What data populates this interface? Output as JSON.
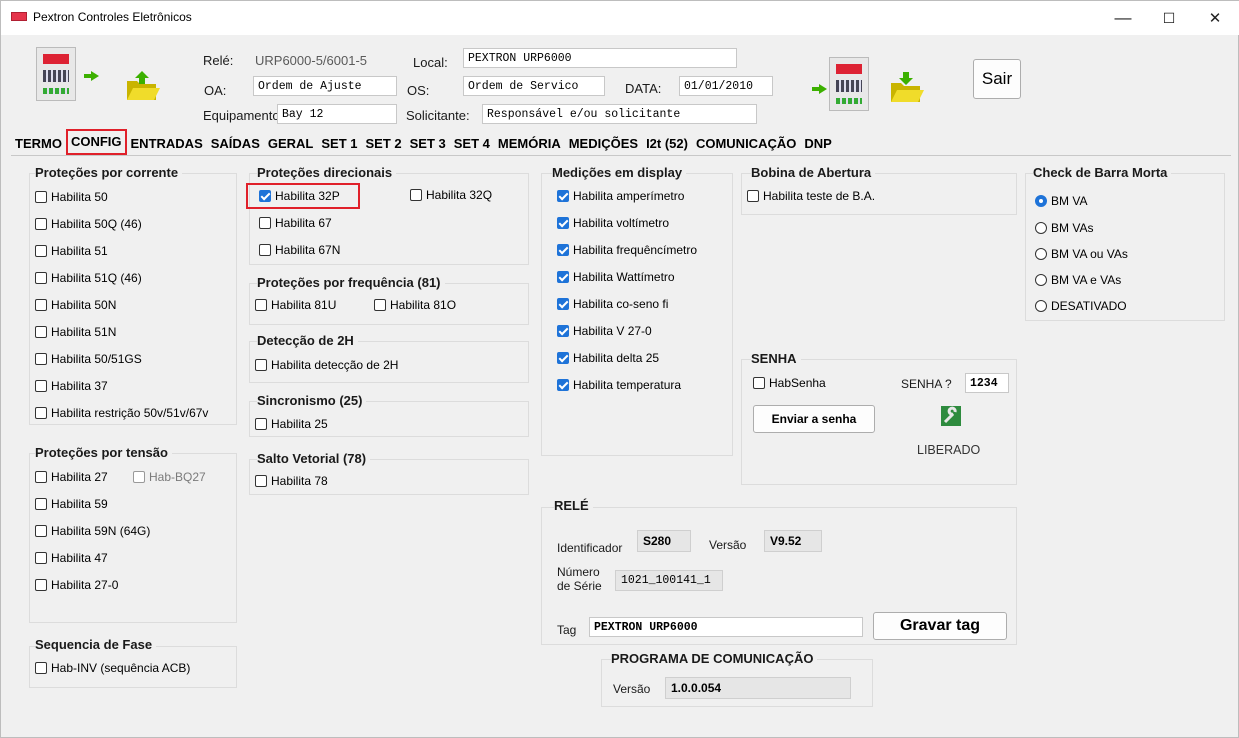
{
  "window": {
    "title": "Pextron Controles Eletrônicos",
    "min": "—",
    "max": "☐",
    "close": "✕"
  },
  "header": {
    "rele_label": "Relé:",
    "rele_value": "URP6000-5/6001-5",
    "local_label": "Local:",
    "local_value": "PEXTRON URP6000",
    "oa_label": "OA:",
    "oa_value": "Ordem de Ajuste",
    "os_label": "OS:",
    "os_value": "Ordem de Servico",
    "data_label": "DATA:",
    "data_value": "01/01/2010",
    "equip_label": "Equipamento:",
    "equip_value": "Bay 12",
    "solic_label": "Solicitante:",
    "solic_value": "Responsável e/ou solicitante",
    "sair": "Sair"
  },
  "tabs": [
    "TERMO",
    "CONFIG",
    "ENTRADAS",
    "SAÍDAS",
    "GERAL",
    "SET 1",
    "SET 2",
    "SET 3",
    "SET 4",
    "MEMÓRIA",
    "MEDIÇÕES",
    "I2t (52)",
    "COMUNICAÇÃO",
    "DNP"
  ],
  "protecoes_corrente": {
    "title": "Proteções por corrente",
    "items": [
      "Habilita 50",
      "Habilita 50Q (46)",
      "Habilita 51",
      "Habilita 51Q (46)",
      "Habilita 50N",
      "Habilita 51N",
      "Habilita 50/51GS",
      "Habilita 37",
      "Habilita restrição 50v/51v/67v"
    ]
  },
  "protecoes_tensao": {
    "title": "Proteções por tensão",
    "items": [
      "Habilita 27",
      "Hab-BQ27",
      "Habilita 59",
      "Habilita 59N (64G)",
      "Habilita 47",
      "Habilita 27-0"
    ]
  },
  "sequencia": {
    "title": "Sequencia de Fase",
    "item": "Hab-INV (sequência ACB)"
  },
  "direcionais": {
    "title": "Proteções direcionais",
    "items": [
      "Habilita 32P",
      "Habilita 32Q",
      "Habilita 67",
      "Habilita 67N"
    ]
  },
  "frequencia": {
    "title": "Proteções por frequência (81)",
    "items": [
      "Habilita 81U",
      "Habilita 81O"
    ]
  },
  "deteccao": {
    "title": "Detecção de 2H",
    "item": "Habilita detecção de 2H"
  },
  "sincronismo": {
    "title": "Sincronismo (25)",
    "item": "Habilita 25"
  },
  "salto": {
    "title": "Salto Vetorial (78)",
    "item": "Habilita 78"
  },
  "medicoes": {
    "title": "Medições em display",
    "items": [
      "Habilita amperímetro",
      "Habilita voltímetro",
      "Habilita frequêncímetro",
      "Habilita Wattímetro",
      "Habilita co-seno fi",
      "Habilita V 27-0",
      "Habilita delta 25",
      "Habilita temperatura"
    ]
  },
  "bobina": {
    "title": "Bobina de Abertura",
    "item": "Habilita teste de B.A."
  },
  "senha": {
    "title": "SENHA",
    "hab": "HabSenha",
    "label": "SENHA ?",
    "value": "1234",
    "enviar": "Enviar a senha",
    "status": "LIBERADO"
  },
  "barra_morta": {
    "title": "Check de Barra Morta",
    "options": [
      "BM VA",
      "BM VAs",
      "BM VA ou VAs",
      "BM VA e VAs",
      "DESATIVADO"
    ],
    "selected": "BM VA"
  },
  "rele": {
    "title": "RELÉ",
    "id_label": "Identificador",
    "id_value": "S280",
    "ver_label": "Versão",
    "ver_value": "V9.52",
    "serie_label1": "Número",
    "serie_label2": "de Série",
    "serie_value": "1021_100141_1",
    "tag_label": "Tag",
    "tag_value": "PEXTRON URP6000",
    "gravar": "Gravar tag"
  },
  "programa": {
    "title": "PROGRAMA DE COMUNICAÇÃO",
    "ver_label": "Versão",
    "ver_value": "1.0.0.054"
  },
  "colors": {
    "accent": "#1e73d8",
    "highlight": "#e0202a",
    "background": "#f0f0f0"
  }
}
